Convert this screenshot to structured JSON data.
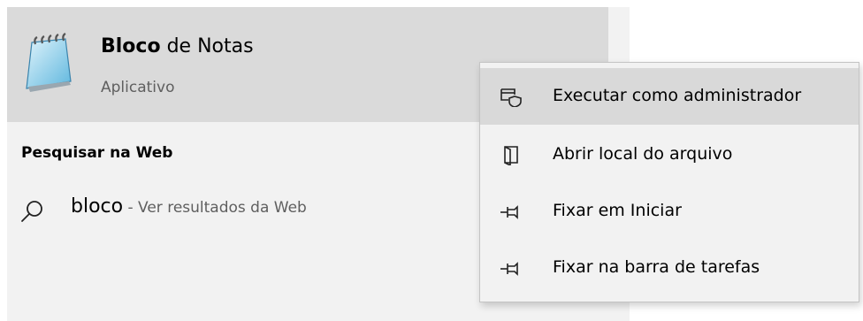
{
  "best_match": {
    "title_bold": "Bloco",
    "title_rest": " de Notas",
    "subtitle": "Aplicativo",
    "icon": "notepad-icon"
  },
  "web": {
    "heading": "Pesquisar na Web",
    "query": "bloco",
    "suffix": " - Ver resultados da Web",
    "icon": "search-icon"
  },
  "context_menu": {
    "items": [
      {
        "label": "Executar como administrador",
        "icon": "run-as-admin-icon",
        "highlighted": true
      },
      {
        "label": "Abrir local do arquivo",
        "icon": "open-file-location-icon",
        "highlighted": false
      },
      {
        "label": "Fixar em Iniciar",
        "icon": "pin-icon",
        "highlighted": false
      },
      {
        "label": "Fixar na barra de tarefas",
        "icon": "pin-icon",
        "highlighted": false
      }
    ]
  },
  "colors": {
    "panel": "#f2f2f2",
    "selected": "#dadada",
    "menu_hover": "#d9d9d9",
    "secondary_text": "#5f5f5f"
  }
}
